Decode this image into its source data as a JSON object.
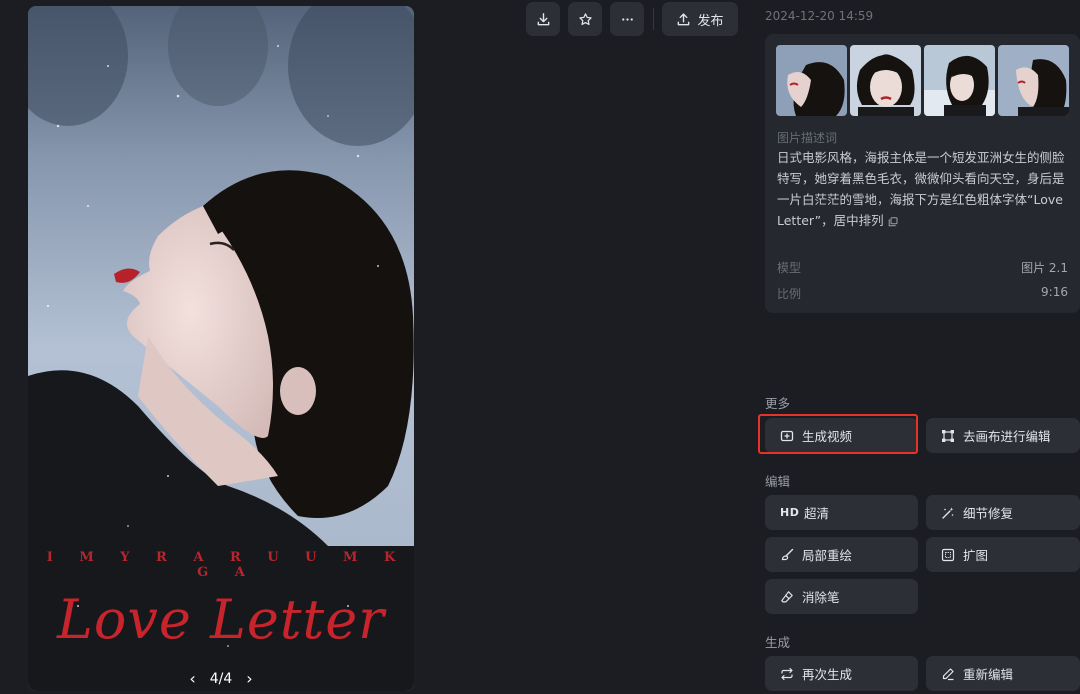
{
  "image": {
    "poster_subtitle": "I M Y R A R U U M K G A",
    "poster_title": "Love Letter",
    "pager_text": "4/4",
    "current_page": 4,
    "total_pages": 4
  },
  "toolbar": {
    "download_icon": "download-icon",
    "favorite_icon": "star-icon",
    "more_icon": "more-icon",
    "publish_label": "发布"
  },
  "details": {
    "timestamp": "2024-12-20 14:59",
    "thumbnail_count": 4,
    "prompt_label": "图片描述词",
    "prompt_text": "日式电影风格，海报主体是一个短发亚洲女生的侧脸特写，她穿着黑色毛衣，微微仰头看向天空，身后是一片白茫茫的雪地，海报下方是红色粗体字体“Love Letter”，居中排列",
    "model_key": "模型",
    "model_value": "图片 2.1",
    "ratio_key": "比例",
    "ratio_value": "9:16"
  },
  "more": {
    "label": "更多",
    "generate_video": "生成视频",
    "edit_on_canvas": "去画布进行编辑"
  },
  "edit": {
    "label": "编辑",
    "hd_badge": "HD",
    "upscale": "超清",
    "detail_repair": "细节修复",
    "inpaint": "局部重绘",
    "outpaint": "扩图",
    "eraser": "消除笔"
  },
  "generate": {
    "label": "生成",
    "regenerate": "再次生成",
    "re_edit": "重新编辑"
  },
  "colors": {
    "background": "#1b1d22",
    "button": "#2c2f36",
    "card": "#25282e",
    "highlight": "#e5332a",
    "poster_red": "#c8242c"
  }
}
